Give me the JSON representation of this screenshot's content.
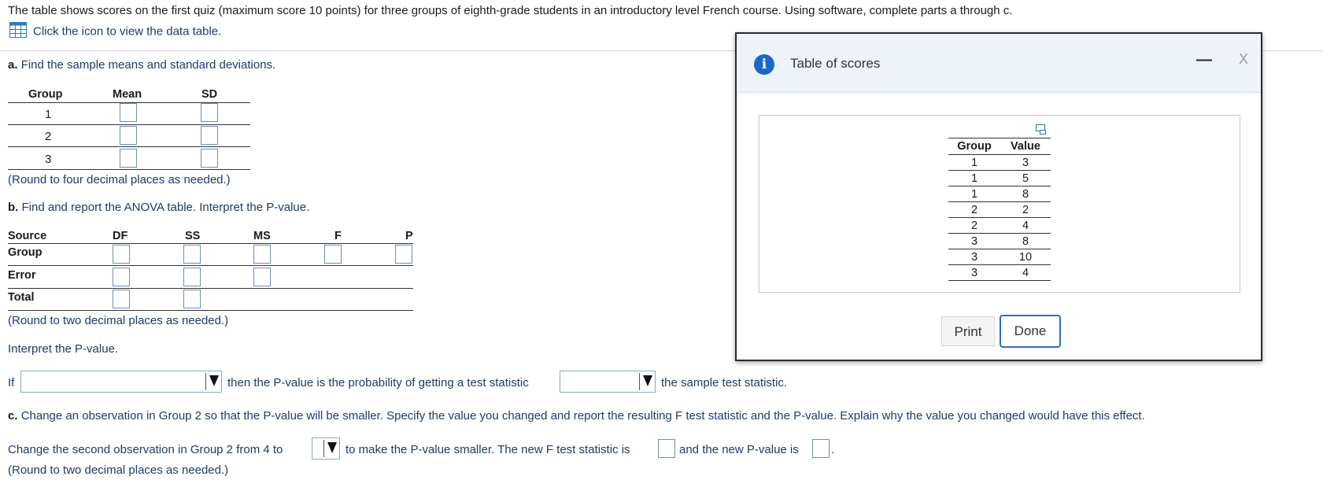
{
  "intro": {
    "text": "The table shows scores on the first quiz (maximum score 10 points) for three groups of eighth-grade students in an introductory level French course. Using software, complete parts a through c.",
    "data_link": "Click the icon to view the data table."
  },
  "part_a": {
    "label": "a.",
    "question": "Find the sample means and standard deviations.",
    "headers": [
      "Group",
      "Mean",
      "SD"
    ],
    "rows": [
      "1",
      "2",
      "3"
    ],
    "note": "(Round to four decimal places as needed.)"
  },
  "part_b": {
    "label": "b.",
    "question": "Find and report the ANOVA table. Interpret the P-value.",
    "headers": [
      "Source",
      "DF",
      "SS",
      "MS",
      "F",
      "P"
    ],
    "rows": [
      "Group",
      "Error",
      "Total"
    ],
    "note": "(Round to two decimal places as needed.)",
    "interpret_label": "Interpret the P-value.",
    "if_word": "If",
    "then_text": "then the P-value is the probability of getting a test statistic",
    "end_text": "the sample test statistic."
  },
  "part_c": {
    "label": "c.",
    "question": "Change an observation in Group 2 so that the P-value will be smaller. Specify the value you changed and report the resulting F test statistic and the P-value. Explain why the value you changed would have this effect.",
    "sentence_1": "Change the second observation in Group 2 from 4 to",
    "sentence_2": "to make the P-value smaller. The new F test statistic is",
    "sentence_3": "and the new P-value is",
    "period": ".",
    "note": "(Round to two decimal places as needed.)"
  },
  "modal": {
    "title": "Table of scores",
    "minimize": "—",
    "close": "X",
    "table_headers": [
      "Group",
      "Value"
    ],
    "table_rows": [
      [
        "1",
        "3"
      ],
      [
        "1",
        "5"
      ],
      [
        "1",
        "8"
      ],
      [
        "2",
        "2"
      ],
      [
        "2",
        "4"
      ],
      [
        "3",
        "8"
      ],
      [
        "3",
        "10"
      ],
      [
        "3",
        "4"
      ]
    ],
    "print_label": "Print",
    "done_label": "Done"
  },
  "colors": {
    "accent": "#1967c8",
    "input_border": "#6d8fb3",
    "link_text": "#1f3a68"
  }
}
